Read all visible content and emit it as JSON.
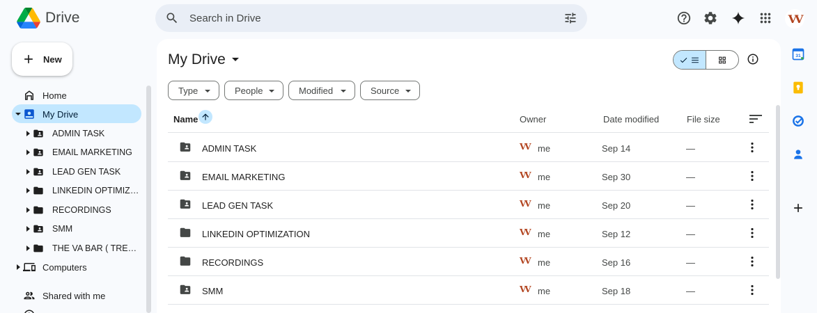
{
  "app": {
    "name": "Drive"
  },
  "search": {
    "placeholder": "Search in Drive"
  },
  "user": {
    "avatar_text": "VV"
  },
  "new_button": {
    "label": "New"
  },
  "sidebar": {
    "home": "Home",
    "my_drive": "My Drive",
    "folders": [
      {
        "label": "ADMIN TASK",
        "shared": true
      },
      {
        "label": "EMAIL MARKETING",
        "shared": true
      },
      {
        "label": "LEAD GEN TASK",
        "shared": true
      },
      {
        "label": "LINKEDIN OPTIMIZATION",
        "shared": false
      },
      {
        "label": "RECORDINGS",
        "shared": false
      },
      {
        "label": "SMM",
        "shared": true
      },
      {
        "label": "THE VA BAR ( TRELLO BOARD )",
        "shared": false
      }
    ],
    "computers": "Computers",
    "shared_with_me": "Shared with me"
  },
  "main": {
    "title": "My Drive",
    "filters": [
      "Type",
      "People",
      "Modified",
      "Source"
    ],
    "columns": {
      "name": "Name",
      "owner": "Owner",
      "date_modified": "Date modified",
      "file_size": "File size"
    },
    "rows": [
      {
        "name": "ADMIN TASK",
        "owner": "me",
        "date": "Sep 14",
        "size": "—",
        "shared": true
      },
      {
        "name": "EMAIL MARKETING",
        "owner": "me",
        "date": "Sep 30",
        "size": "—",
        "shared": true
      },
      {
        "name": "LEAD GEN TASK",
        "owner": "me",
        "date": "Sep 20",
        "size": "—",
        "shared": true
      },
      {
        "name": "LINKEDIN OPTIMIZATION",
        "owner": "me",
        "date": "Sep 12",
        "size": "—",
        "shared": false
      },
      {
        "name": "RECORDINGS",
        "owner": "me",
        "date": "Sep 16",
        "size": "—",
        "shared": false
      },
      {
        "name": "SMM",
        "owner": "me",
        "date": "Sep 18",
        "size": "—",
        "shared": true
      }
    ]
  },
  "colors": {
    "accent": "#0b57d0",
    "selected_bg": "#c2e7ff",
    "page_bg": "#f8fafd",
    "search_bg": "#e9eef6",
    "icon": "#444746"
  },
  "icons": [
    "drive-logo",
    "search-icon",
    "tune-icon",
    "help-icon",
    "settings-icon",
    "gemini-icon",
    "apps-icon",
    "plus-icon",
    "home-icon",
    "my-drive-icon",
    "shared-folder-icon",
    "folder-icon",
    "computers-icon",
    "shared-with-me-icon",
    "list-view-icon",
    "grid-view-icon",
    "info-icon",
    "sort-icon",
    "more-vert-icon",
    "calendar-icon",
    "keep-icon",
    "tasks-icon",
    "contacts-icon"
  ]
}
